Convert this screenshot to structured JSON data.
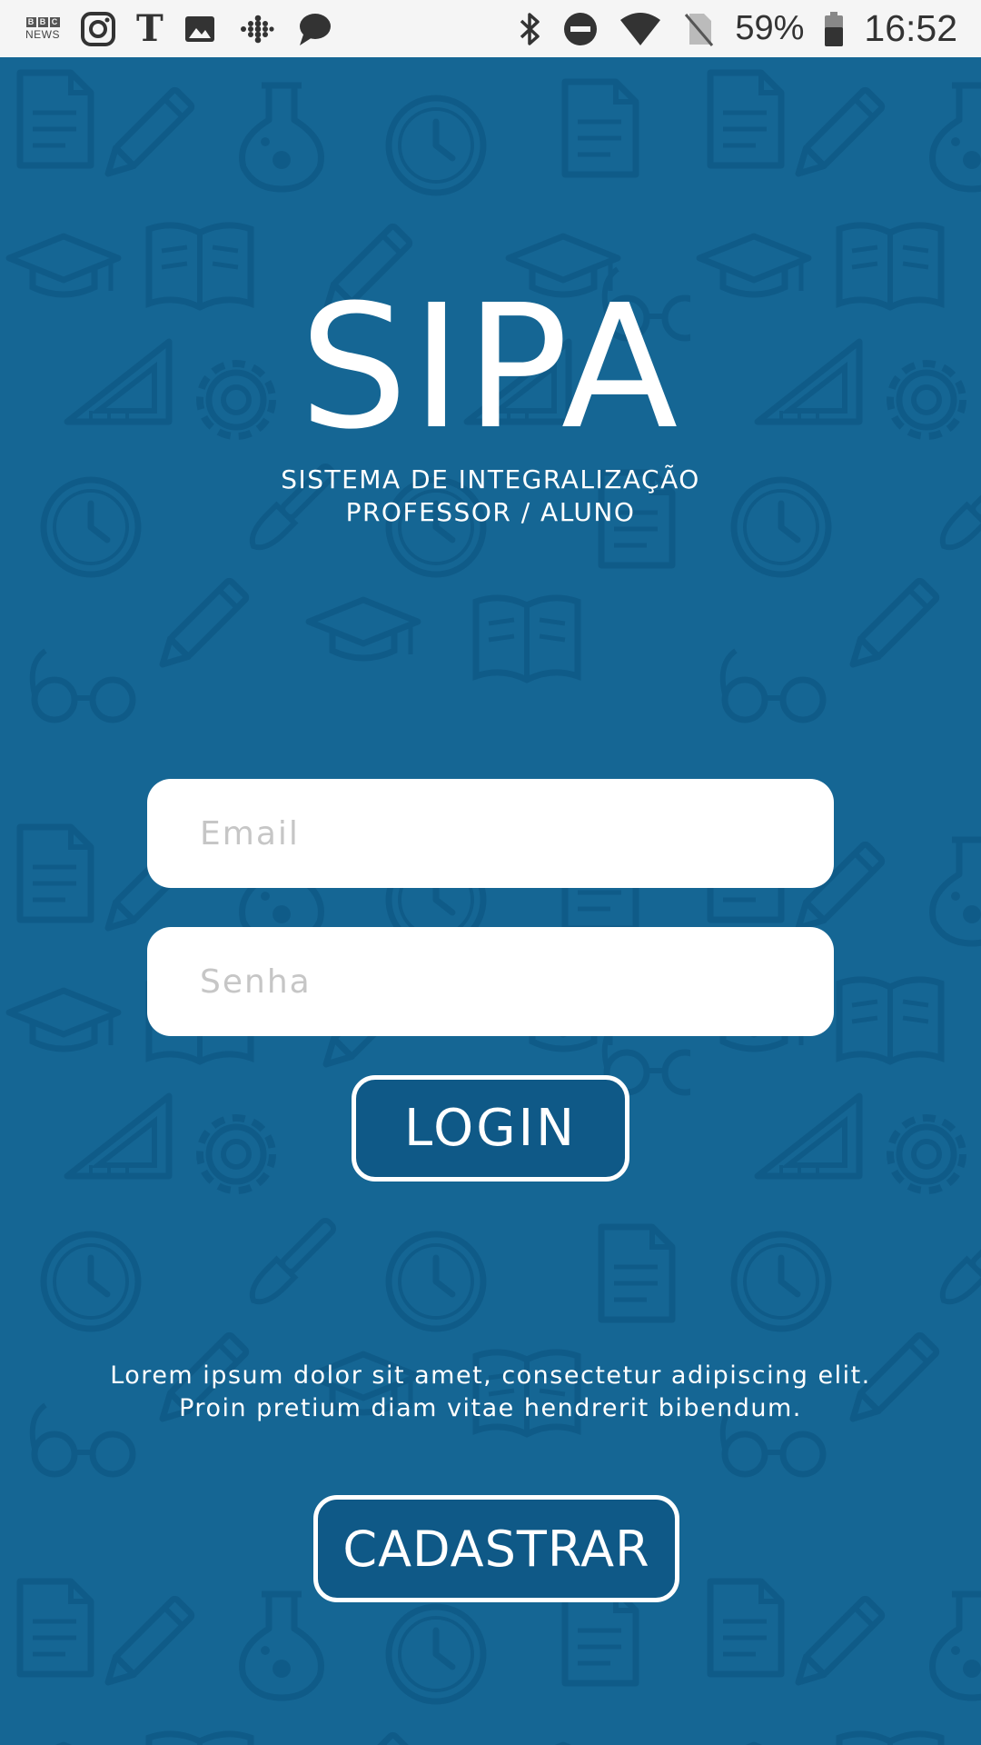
{
  "status_bar": {
    "left_icons": [
      "bbc-news-icon",
      "instagram-icon",
      "nytimes-icon",
      "gallery-icon",
      "fitbit-icon",
      "chat-bubble-icon"
    ],
    "bbc_top": [
      "B",
      "B",
      "C"
    ],
    "bbc_bottom": "NEWS",
    "nyt_glyph": "T",
    "right_icons": [
      "bluetooth-icon",
      "do-not-disturb-icon",
      "wifi-icon",
      "no-sim-icon",
      "battery-icon"
    ],
    "battery_percent": "59%",
    "time": "16:52"
  },
  "logo": {
    "title": "SIPA",
    "subtitle_line1": "SISTEMA DE INTEGRALIZAÇÃO",
    "subtitle_line2": "PROFESSOR / ALUNO"
  },
  "form": {
    "email_placeholder": "Email",
    "email_value": "",
    "password_placeholder": "Senha",
    "password_value": "",
    "login_label": "LOGIN"
  },
  "info": {
    "line1": "Lorem ipsum dolor sit amet, consectetur adipiscing elit.",
    "line2": "Proin pretium diam vitae hendrerit bibendum."
  },
  "register": {
    "label": "CADASTRAR"
  },
  "colors": {
    "background": "#156694",
    "pattern": "#0f5b88",
    "button_fill": "#0f5987",
    "button_border": "#ffffff",
    "status_bar": "#f5f5f5"
  }
}
